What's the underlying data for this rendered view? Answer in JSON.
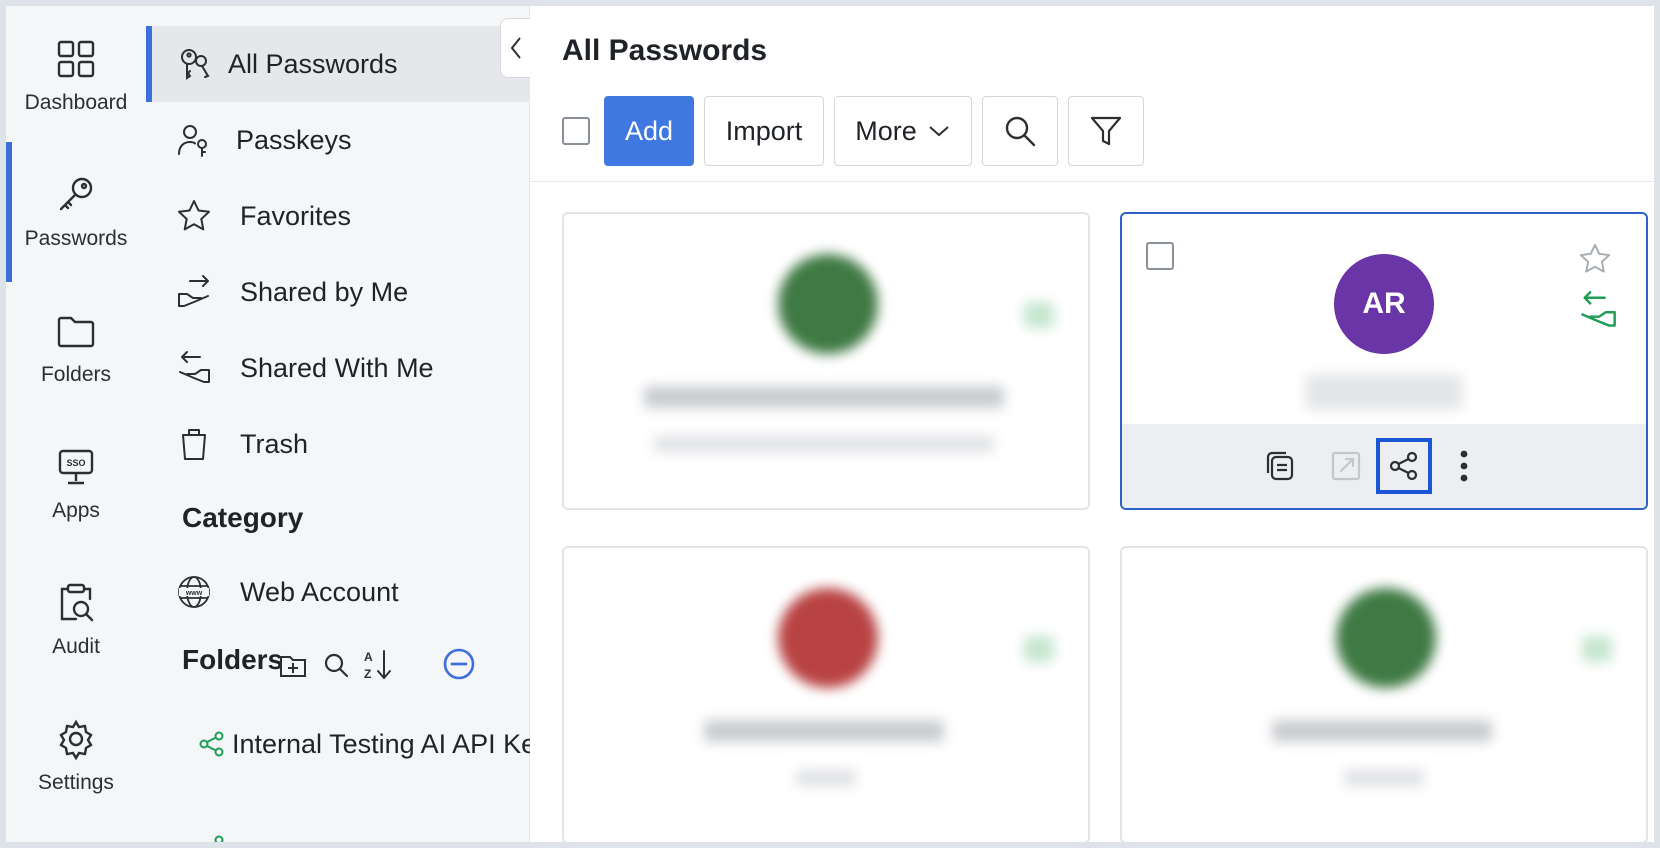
{
  "rail": {
    "items": [
      {
        "label": "Dashboard",
        "icon": "dashboard-icon"
      },
      {
        "label": "Passwords",
        "icon": "key-icon"
      },
      {
        "label": "Folders",
        "icon": "folder-icon"
      },
      {
        "label": "Apps",
        "icon": "sso-icon"
      },
      {
        "label": "Audit",
        "icon": "audit-icon"
      },
      {
        "label": "Settings",
        "icon": "gear-icon"
      }
    ]
  },
  "subnav": {
    "items": [
      {
        "label": "All Passwords",
        "icon": "keys-icon"
      },
      {
        "label": "Passkeys",
        "icon": "passkey-icon"
      },
      {
        "label": "Favorites",
        "icon": "star-icon"
      },
      {
        "label": "Shared by Me",
        "icon": "share-out-icon"
      },
      {
        "label": "Shared With Me",
        "icon": "share-in-icon"
      },
      {
        "label": "Trash",
        "icon": "trash-icon"
      }
    ],
    "category_heading": "Category",
    "category_items": [
      {
        "label": "Web Account",
        "icon": "www-icon"
      }
    ],
    "folders_heading": "Folders",
    "folder_items": [
      {
        "label": "Internal Testing AI API Ke",
        "icon": "shared-folder-icon"
      }
    ]
  },
  "main": {
    "title": "All Passwords",
    "toolbar": {
      "add_label": "Add",
      "import_label": "Import",
      "more_label": "More"
    },
    "cards": [
      {
        "avatar_text": "",
        "avatar_color": "#3f7a44",
        "blurred": true
      },
      {
        "avatar_text": "AR",
        "avatar_color": "#6a35a6",
        "blurred": false,
        "selected": true
      },
      {
        "avatar_text": "",
        "avatar_color": "#b94343",
        "blurred": true
      },
      {
        "avatar_text": "",
        "avatar_color": "#3f7a44",
        "blurred": true
      }
    ]
  },
  "colors": {
    "accent": "#3b6fd9",
    "primary_button": "#3f78e0",
    "shared_green": "#1f9d55",
    "focus_blue": "#1a56d6"
  }
}
